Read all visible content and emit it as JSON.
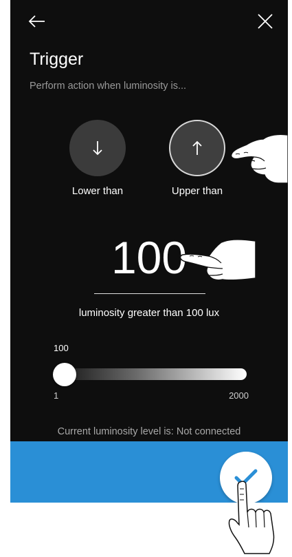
{
  "header": {
    "back_icon": "arrow-left-icon",
    "close_icon": "close-icon"
  },
  "title": "Trigger",
  "subtitle": "Perform action when luminosity is...",
  "options": [
    {
      "label": "Lower than",
      "icon": "arrow-down-icon",
      "selected": false
    },
    {
      "label": "Upper than",
      "icon": "arrow-up-icon",
      "selected": true
    }
  ],
  "threshold": {
    "value": "100",
    "description": "luminosity greater than 100 lux"
  },
  "slider": {
    "current": "100",
    "min": "1",
    "max": "2000"
  },
  "status": "Current luminosity level is: Not connected",
  "confirm": {
    "icon": "checkmark-icon"
  },
  "colors": {
    "background": "#0e0e0e",
    "accent": "#2a8fd6",
    "check": "#2a8fd6"
  }
}
